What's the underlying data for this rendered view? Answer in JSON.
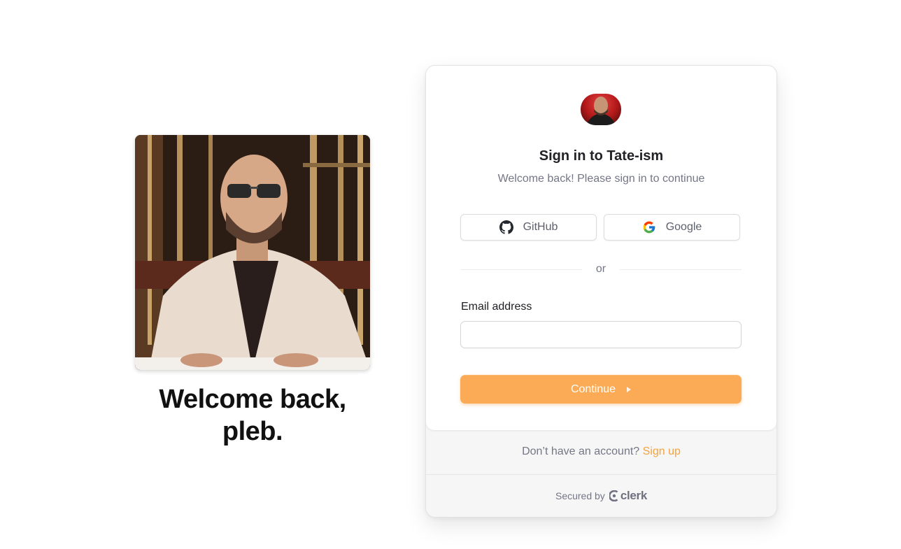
{
  "hero": {
    "image_alt": "photo-of-man-in-sunglasses",
    "title_line1": "Welcome back,",
    "title_line2": "pleb."
  },
  "card": {
    "logo_icon": "app-avatar-logo",
    "title": "Sign in to Tate-ism",
    "subtitle": "Welcome back! Please sign in to continue",
    "social": [
      {
        "label": "GitHub",
        "icon": "github-icon"
      },
      {
        "label": "Google",
        "icon": "google-icon"
      }
    ],
    "divider": "or",
    "email": {
      "label": "Email address",
      "value": "",
      "placeholder": ""
    },
    "continue_label": "Continue",
    "footer": {
      "prompt": "Don’t have an account?",
      "signup_link": "Sign up",
      "secured_by": "Secured by",
      "brand": "clerk"
    }
  },
  "colors": {
    "accent": "#fbab55",
    "link": "#f5a23b",
    "muted_text": "#747686"
  }
}
